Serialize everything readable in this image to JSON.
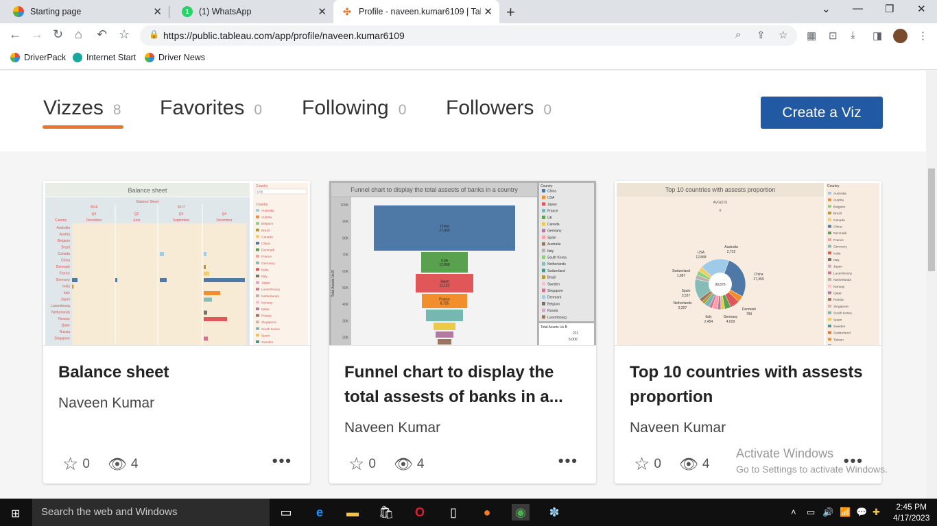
{
  "browser": {
    "tabs": [
      {
        "title": "Starting page"
      },
      {
        "title": "(1) WhatsApp"
      },
      {
        "title": "Profile - naveen.kumar6109 | Tab"
      }
    ],
    "url": "https://public.tableau.com/app/profile/naveen.kumar6109",
    "bookmarks": [
      "DriverPack",
      "Internet Start",
      "Driver News"
    ]
  },
  "profile": {
    "tabs": [
      {
        "label": "Vizzes",
        "count": "8"
      },
      {
        "label": "Favorites",
        "count": "0"
      },
      {
        "label": "Following",
        "count": "0"
      },
      {
        "label": "Followers",
        "count": "0"
      }
    ],
    "create_button": "Create a Viz"
  },
  "cards": [
    {
      "title": "Balance sheet",
      "author": "Naveen Kumar",
      "favorites": "0",
      "views": "4",
      "thumb": {
        "title": "Balance sheet",
        "subtitle": "Balance Sheet",
        "years": [
          "2016",
          "2017"
        ],
        "quarters": [
          "Q4",
          "Q2",
          "Q3",
          "Q4"
        ],
        "months": [
          "December",
          "June",
          "September",
          "December"
        ],
        "filter_label": "Country",
        "filter_value": "(All)",
        "country_header": "Country",
        "countries": [
          "Australia",
          "Austria",
          "Belgium",
          "Brazil",
          "Canada",
          "China",
          "Denmark",
          "France",
          "Germany",
          "India",
          "Italy",
          "Japan",
          "Luxembourg",
          "Netherlands",
          "Norway",
          "Qatar",
          "Russia",
          "Singapore"
        ],
        "legend": [
          "Australia",
          "Austria",
          "Belgium",
          "Brazil",
          "Canada",
          "China",
          "Denmark",
          "France",
          "Germany",
          "India",
          "Italy",
          "Japan",
          "Luxembourg",
          "Netherlands",
          "Norway",
          "Qatar",
          "Russia",
          "Singapore",
          "South Korea",
          "Spain",
          "Sweden"
        ]
      }
    },
    {
      "title": "Funnel chart to display the total assests of banks in a...",
      "author": "Naveen Kumar",
      "favorites": "0",
      "views": "4",
      "thumb": {
        "title": "Funnel chart to display the total assests of banks in a country",
        "y_label": "Total Assets Us B",
        "y_ticks": [
          "100K",
          "90K",
          "80K",
          "70K",
          "60K",
          "50K",
          "40K",
          "30K",
          "20K"
        ],
        "funnel": [
          {
            "name": "China",
            "value": "27,459",
            "color": "#4e79a7"
          },
          {
            "name": "USA",
            "value": "12,868",
            "color": "#59a14f"
          },
          {
            "name": "Japan",
            "value": "11,122",
            "color": "#e15759"
          },
          {
            "name": "France",
            "value": "8,725",
            "color": "#f28e2b"
          },
          {
            "name": "",
            "value": "",
            "color": "#76b7b2"
          },
          {
            "name": "",
            "value": "",
            "color": "#edc948"
          },
          {
            "name": "",
            "value": "",
            "color": "#b07aa1"
          },
          {
            "name": "",
            "value": "",
            "color": "#9c755f"
          }
        ],
        "legend_title": "Country",
        "legend": [
          "China",
          "USA",
          "Japan",
          "France",
          "UK",
          "Canada",
          "Germany",
          "Spain",
          "Australia",
          "Italy",
          "South Korea",
          "Netherlands",
          "Switzerland",
          "Brazil",
          "Sweden",
          "Singapore",
          "Denmark",
          "Belgium",
          "Russia",
          "Luxembourg"
        ],
        "size_title": "Total Assets Us B",
        "size_values": [
          "221",
          "5,000"
        ]
      }
    },
    {
      "title": "Top 10 countries with assests proportion",
      "author": "Naveen Kumar",
      "favorites": "0",
      "views": "4",
      "thumb": {
        "title": "Top 10 countries with assests proportion",
        "avg_label": "AVG(0.0)",
        "avg_value": "0",
        "center_value": "99,876",
        "pie_labels": [
          {
            "name": "China",
            "value": "27,459"
          },
          {
            "name": "USA",
            "value": "12,868"
          },
          {
            "name": "Australia",
            "value": "2,732"
          },
          {
            "name": "Switzerland",
            "value": "1,987"
          },
          {
            "name": "Spain",
            "value": "3,537"
          },
          {
            "name": "Netherlands",
            "value": "2,207"
          },
          {
            "name": "Italy",
            "value": "2,454"
          },
          {
            "name": "Germany",
            "value": "4,029"
          },
          {
            "name": "Denmark",
            "value": "799"
          }
        ],
        "legend_title": "Country",
        "legend": [
          "Australia",
          "Austria",
          "Belgium",
          "Brazil",
          "Canada",
          "China",
          "Denmark",
          "France",
          "Germany",
          "India",
          "Italy",
          "Japan",
          "Luxembourg",
          "Netherlands",
          "Norway",
          "Qatar",
          "Russia",
          "Singapore",
          "South Korea",
          "Spain",
          "Sweden",
          "Switzerland",
          "Taiwan",
          "UK"
        ]
      }
    }
  ],
  "watermark": {
    "line1": "Activate Windows",
    "line2": "Go to Settings to activate Windows."
  },
  "taskbar": {
    "search_placeholder": "Search the web and Windows",
    "time": "2:45 PM",
    "date": "4/17/2023"
  },
  "colors": {
    "accent_orange": "#e8762d",
    "create_button": "#2259a3"
  }
}
